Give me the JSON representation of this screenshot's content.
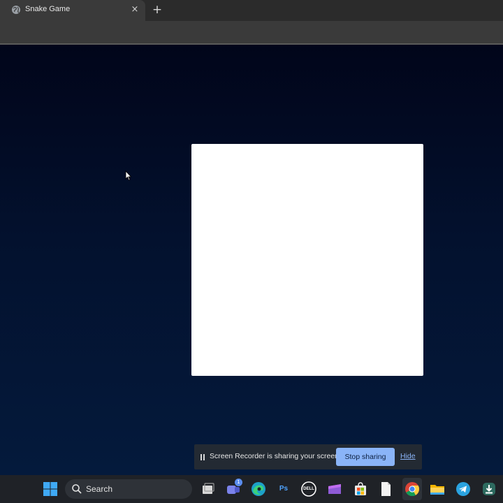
{
  "browser": {
    "tab": {
      "title": "Snake Game",
      "close_glyph": "×"
    },
    "new_tab_glyph": "+"
  },
  "screen_share": {
    "message": "Screen Recorder is sharing your screen.",
    "stop_label": "Stop sharing",
    "hide_label": "Hide"
  },
  "taskbar": {
    "search_label": "Search",
    "chat_badge": "1",
    "photoshop_label": "Ps",
    "dell_label": "DELL",
    "icons": [
      "windows-start-icon",
      "search-icon",
      "task-view-icon",
      "chat-icon",
      "edge-icon",
      "photoshop-icon",
      "dell-icon",
      "clipchamp-icon",
      "store-icon",
      "file-icon",
      "chrome-icon",
      "file-explorer-icon",
      "telegram-icon",
      "download-app-icon"
    ]
  },
  "colors": {
    "accent": "#8ab4f8",
    "page_top": "#01051a",
    "page_bottom": "#041a3c",
    "board": "#ffffff"
  }
}
